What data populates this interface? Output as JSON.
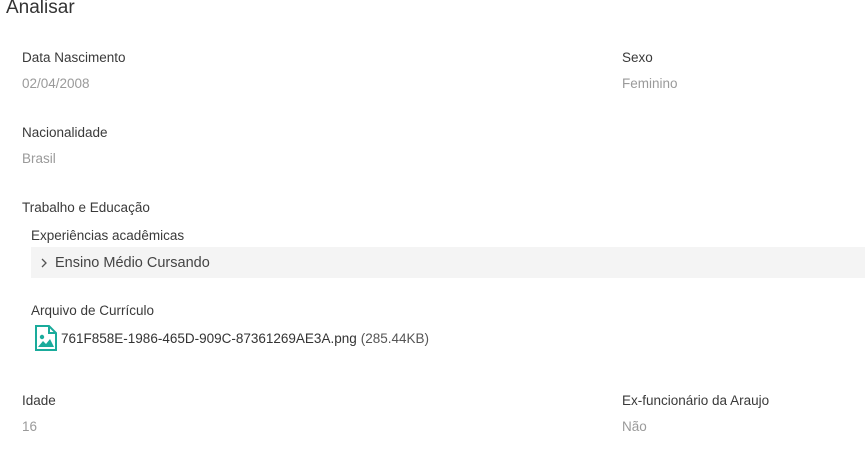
{
  "page": {
    "title": "Analisar"
  },
  "fields": {
    "birth_date": {
      "label": "Data Nascimento",
      "value": "02/04/2008"
    },
    "sex": {
      "label": "Sexo",
      "value": "Feminino"
    },
    "nationality": {
      "label": "Nacionalidade",
      "value": "Brasil"
    },
    "age": {
      "label": "Idade",
      "value": "16"
    },
    "former_employee": {
      "label": "Ex-funcionário da Araujo",
      "value": "Não"
    }
  },
  "work_education": {
    "title": "Trabalho e Educação",
    "academic": {
      "title": "Experiências acadêmicas",
      "items": [
        {
          "label": "Ensino Médio Cursando"
        }
      ]
    },
    "resume": {
      "title": "Arquivo de Currículo",
      "file_name": "761F858E-1986-465D-909C-87361269AE3A.png",
      "file_size": "(285.44KB)",
      "icon": "image-file-icon"
    }
  },
  "colors": {
    "accent": "#1aab9b",
    "label": "#3a3a3a",
    "value": "#9a9a9a",
    "accordion_bg": "#f4f4f4"
  }
}
